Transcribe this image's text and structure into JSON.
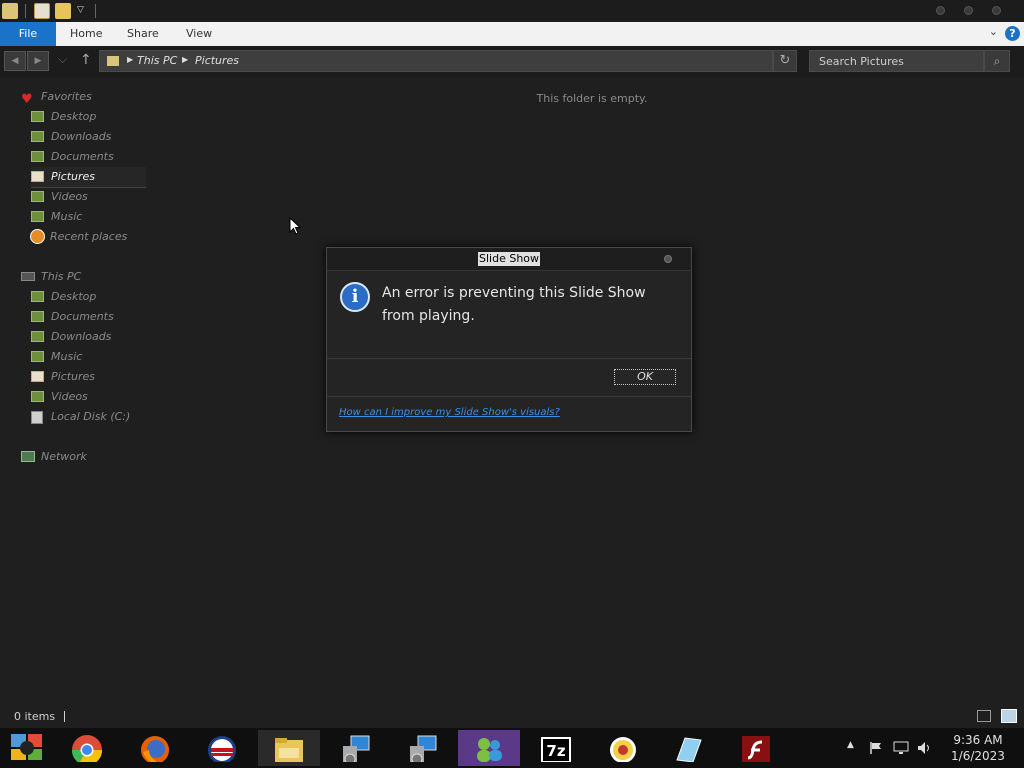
{
  "quick_access": {
    "icons": [
      "folder-icon",
      "properties-icon",
      "new-folder-icon",
      "customize-caret-icon"
    ]
  },
  "ribbon": {
    "tabs": [
      {
        "name": "tab-file",
        "label": "File"
      },
      {
        "name": "tab-home",
        "label": "Home"
      },
      {
        "name": "tab-share",
        "label": "Share"
      },
      {
        "name": "tab-view",
        "label": "View"
      }
    ],
    "help_label": "?"
  },
  "navigation": {
    "address": {
      "crumbs": [
        "This PC",
        "Pictures"
      ]
    },
    "search": {
      "placeholder": "Search Pictures"
    }
  },
  "sidebar": {
    "favorites": {
      "label": "Favorites",
      "items": [
        "Desktop",
        "Downloads",
        "Documents",
        "Pictures",
        "Videos",
        "Music",
        "Recent places"
      ],
      "selected": "Pictures"
    },
    "this_pc": {
      "label": "This PC",
      "items": [
        "Desktop",
        "Documents",
        "Downloads",
        "Music",
        "Pictures",
        "Videos",
        "Local Disk (C:)"
      ]
    },
    "network": {
      "label": "Network"
    }
  },
  "content": {
    "empty_message": "This folder is empty."
  },
  "dialog": {
    "title": "Slide Show",
    "message": "An error is preventing this Slide Show from playing.",
    "ok_label": "OK",
    "link": "How can I improve my Slide Show's visuals?"
  },
  "status": {
    "item_count": "0 items"
  },
  "taskbar": {
    "apps": [
      "start-orb-icon",
      "chrome-icon",
      "firefox-icon",
      "opera-icon",
      "file-explorer-icon",
      "network-setup-icon",
      "network-setup-2-icon",
      "messenger-icon",
      "7zip-icon",
      "media-player-icon",
      "notes-icon",
      "flash-icon"
    ],
    "seven_zip_label": "7z",
    "clock": {
      "time": "9:36 AM",
      "date": "1/6/2023"
    }
  },
  "colors": {
    "accent": "#1a73c8",
    "background": "#1f1f1f",
    "link": "#3a8fe8"
  }
}
